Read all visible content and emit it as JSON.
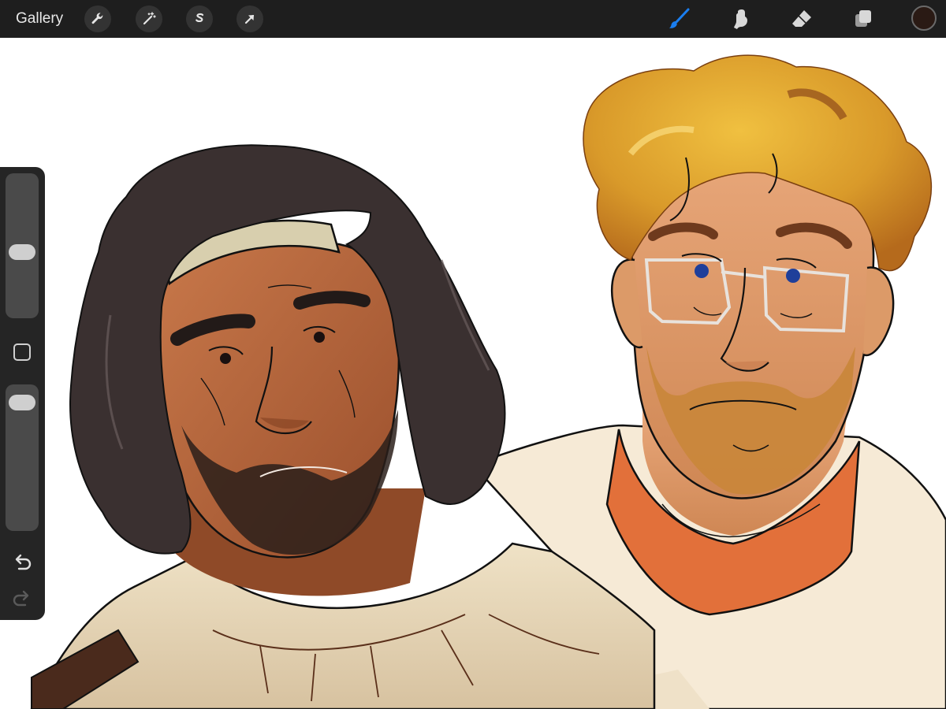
{
  "toolbar": {
    "gallery_label": "Gallery",
    "left_tools": [
      {
        "name": "actions",
        "icon": "wrench-icon"
      },
      {
        "name": "adjustments",
        "icon": "magic-wand-icon"
      },
      {
        "name": "selection",
        "icon": "selection-s-icon"
      },
      {
        "name": "transform",
        "icon": "arrow-cursor-icon"
      }
    ],
    "right_tools": [
      {
        "name": "brush",
        "icon": "brush-icon",
        "active": true
      },
      {
        "name": "smudge",
        "icon": "smudge-finger-icon",
        "active": false
      },
      {
        "name": "eraser",
        "icon": "eraser-icon",
        "active": false
      },
      {
        "name": "layers",
        "icon": "layers-icon",
        "active": false
      }
    ],
    "current_color": "#2a1a14",
    "active_color": "#1a7ef0"
  },
  "sidebar": {
    "brush_size_level": 0.45,
    "opacity_level": 0.92,
    "modify_icon": "square-modify-icon",
    "undo_icon": "undo-arrow-icon",
    "redo_icon": "redo-arrow-icon"
  },
  "canvas": {
    "background": "#ffffff",
    "artwork": "two-character-sketch"
  },
  "colors": {
    "skin_dark": "#b5643a",
    "skin_light": "#dc9a68",
    "hair_dark": "#3a3030",
    "hair_blond": "#d9a233",
    "cloth_cream": "#f3e6cc",
    "shirt_orange": "#e2703a",
    "eye_blue": "#1f3f9a",
    "line": "#111111"
  }
}
